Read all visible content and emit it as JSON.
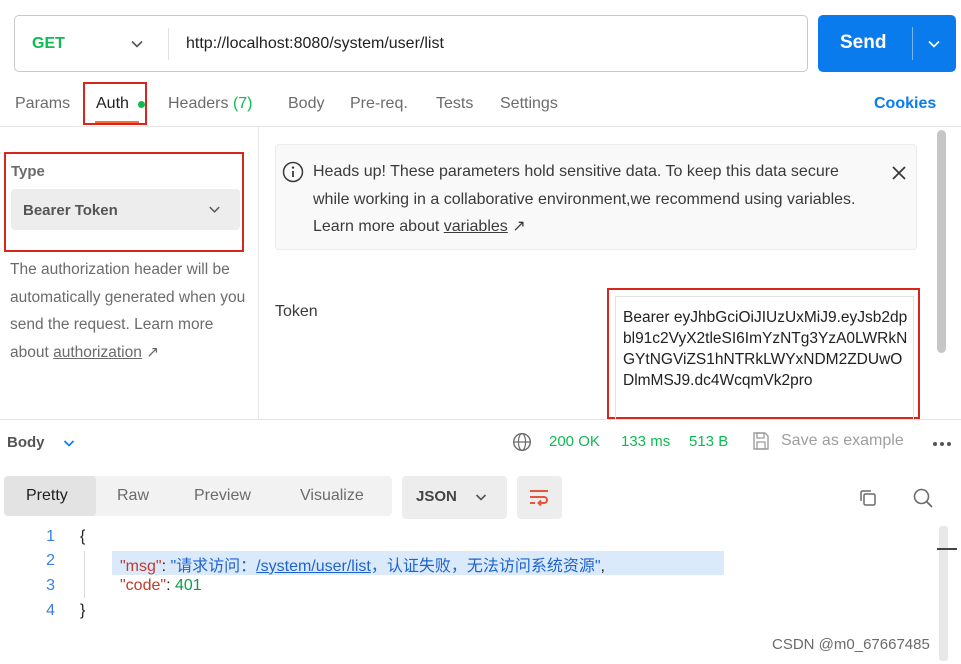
{
  "request": {
    "method": "GET",
    "url": "http://localhost:8080/system/user/list",
    "send_label": "Send"
  },
  "tabs": [
    {
      "label": "Params"
    },
    {
      "label": "Auth"
    },
    {
      "label": "Headers",
      "count": "(7)"
    },
    {
      "label": "Body"
    },
    {
      "label": "Pre-req."
    },
    {
      "label": "Tests"
    },
    {
      "label": "Settings"
    }
  ],
  "cookies_label": "Cookies",
  "auth": {
    "type_label": "Type",
    "type_value": "Bearer Token",
    "description": "The authorization header will be automatically generated when you send the request. Learn more about ",
    "description_link": "authorization",
    "description_link_arrow": "↗"
  },
  "notice": {
    "text": "Heads up! These parameters hold sensitive data. To keep this data secure while working in a collaborative environment,we recommend using variables. Learn more about ",
    "link": "variables",
    "link_arrow": "↗"
  },
  "token": {
    "label": "Token",
    "value": "Bearer eyJhbGciOiJIUzUxMiJ9.eyJsb2dpbl91c2VyX2tleSI6ImYzNTg3YzA0LWRkNGYtNGViZS1hNTRkLWYxNDM2ZDUwODlmMSJ9.dc4WcqmVk2pro"
  },
  "response": {
    "body_label": "Body",
    "status": "200 OK",
    "time": "133 ms",
    "size": "513 B",
    "save_label": "Save as example",
    "view_tabs": [
      "Pretty",
      "Raw",
      "Preview",
      "Visualize"
    ],
    "format": "JSON"
  },
  "code": {
    "line_numbers": [
      "1",
      "2",
      "3",
      "4"
    ],
    "open_brace": "{",
    "close_brace": "}",
    "msg_key": "\"msg\"",
    "msg_prefix": "\"请求访问：",
    "msg_link": "/system/user/list",
    "msg_suffix": "，认证失败，无法访问系统资源\"",
    "code_key": "\"code\"",
    "code_value": "401",
    "colon": ": ",
    "comma": ","
  },
  "watermark": "CSDN @m0_67667485",
  "colors": {
    "accent": "#097bed",
    "success": "#0cbb52",
    "highlight_border": "#d9261c",
    "tab_underline": "#ff6c37"
  }
}
